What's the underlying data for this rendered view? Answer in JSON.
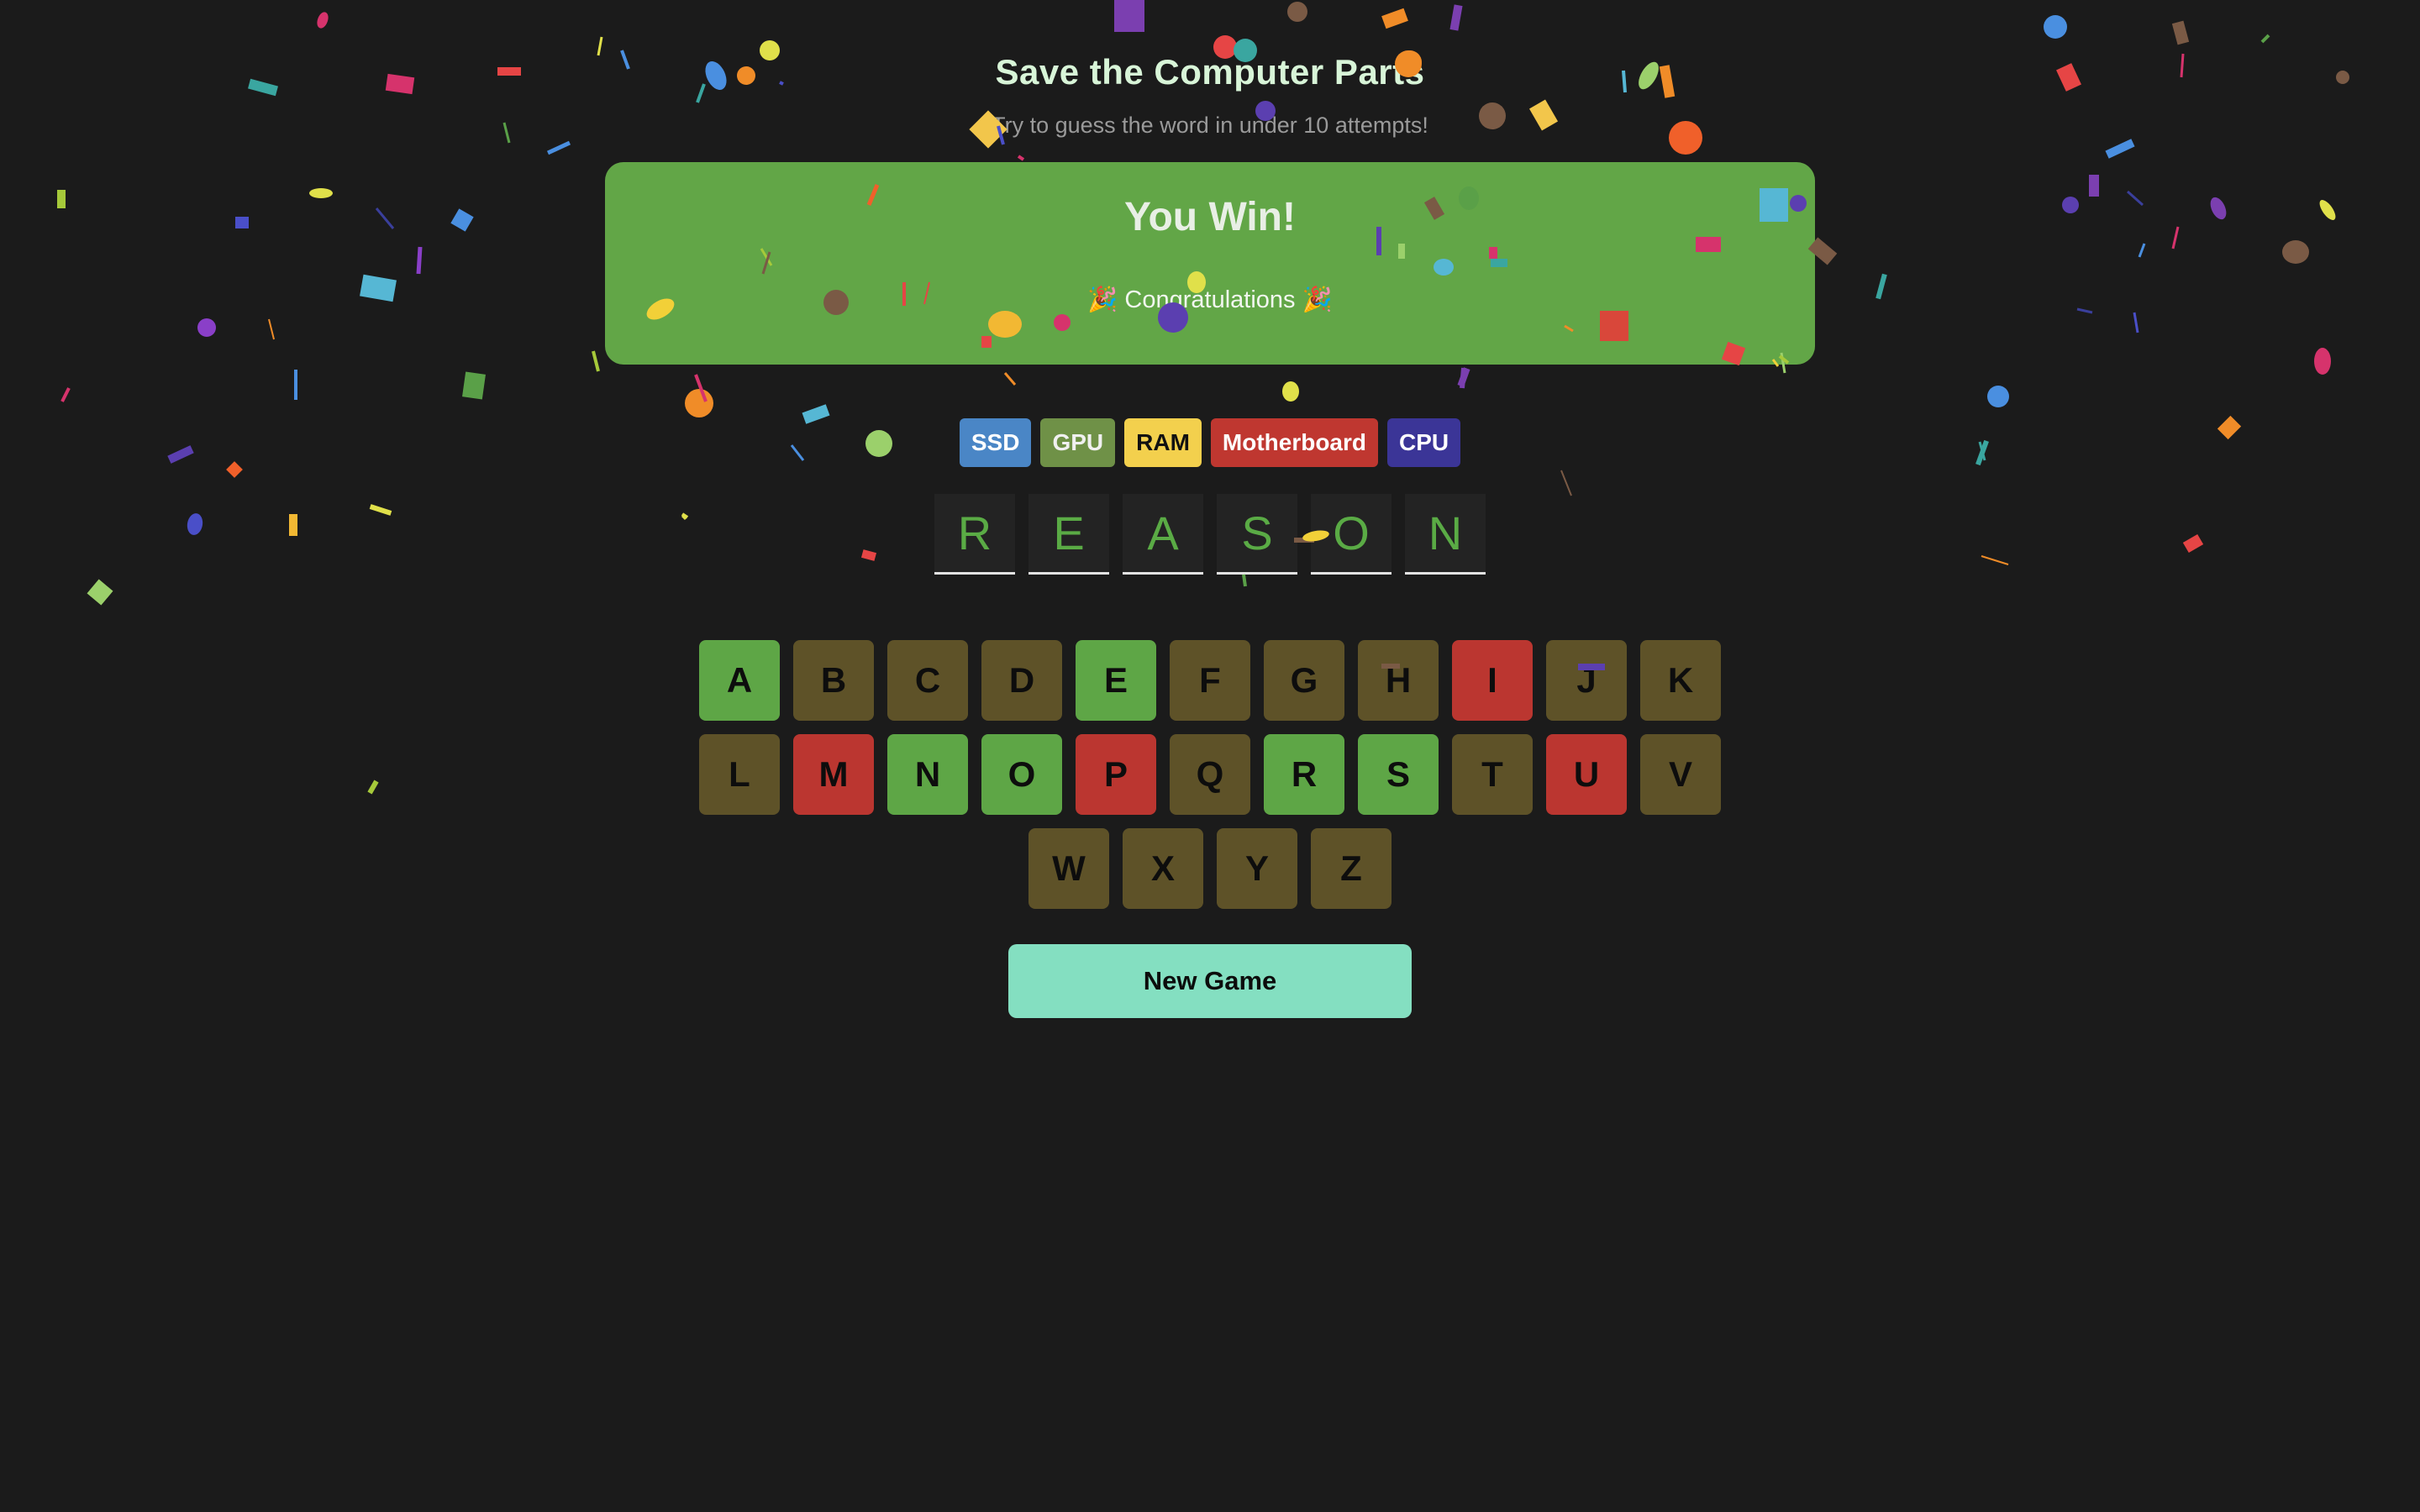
{
  "header": {
    "title": "Save the Computer Parts",
    "subtitle": "Try to guess the word in under 10 attempts!"
  },
  "result": {
    "title": "You Win!",
    "message": "🎉 Congratulations 🎉"
  },
  "categories": [
    {
      "label": "SSD",
      "bg": "#4a86c6",
      "fg": "#ffffff"
    },
    {
      "label": "GPU",
      "bg": "#6f9147",
      "fg": "#f0f0f0"
    },
    {
      "label": "RAM",
      "bg": "#f3d04d",
      "fg": "#111111"
    },
    {
      "label": "Motherboard",
      "bg": "#bf3730",
      "fg": "#ffffff"
    },
    {
      "label": "CPU",
      "bg": "#3b3597",
      "fg": "#ffffff"
    }
  ],
  "word": [
    "R",
    "E",
    "A",
    "S",
    "O",
    "N"
  ],
  "colors": {
    "correct": "#5ea646",
    "wrong": "#bb3630",
    "unused": "#5e5228"
  },
  "keyboard": {
    "rows": [
      [
        {
          "l": "A",
          "s": "correct"
        },
        {
          "l": "B",
          "s": "unused"
        },
        {
          "l": "C",
          "s": "unused"
        },
        {
          "l": "D",
          "s": "unused"
        },
        {
          "l": "E",
          "s": "correct"
        },
        {
          "l": "F",
          "s": "unused"
        },
        {
          "l": "G",
          "s": "unused"
        },
        {
          "l": "H",
          "s": "unused"
        },
        {
          "l": "I",
          "s": "wrong"
        },
        {
          "l": "J",
          "s": "unused"
        },
        {
          "l": "K",
          "s": "unused"
        }
      ],
      [
        {
          "l": "L",
          "s": "unused"
        },
        {
          "l": "M",
          "s": "wrong"
        },
        {
          "l": "N",
          "s": "correct"
        },
        {
          "l": "O",
          "s": "correct"
        },
        {
          "l": "P",
          "s": "wrong"
        },
        {
          "l": "Q",
          "s": "unused"
        },
        {
          "l": "R",
          "s": "correct"
        },
        {
          "l": "S",
          "s": "correct"
        },
        {
          "l": "T",
          "s": "unused"
        },
        {
          "l": "U",
          "s": "wrong"
        },
        {
          "l": "V",
          "s": "unused"
        }
      ],
      [
        {
          "l": "W",
          "s": "unused"
        },
        {
          "l": "X",
          "s": "unused"
        },
        {
          "l": "Y",
          "s": "unused"
        },
        {
          "l": "Z",
          "s": "unused"
        }
      ]
    ]
  },
  "actions": {
    "new_game": "New Game"
  }
}
